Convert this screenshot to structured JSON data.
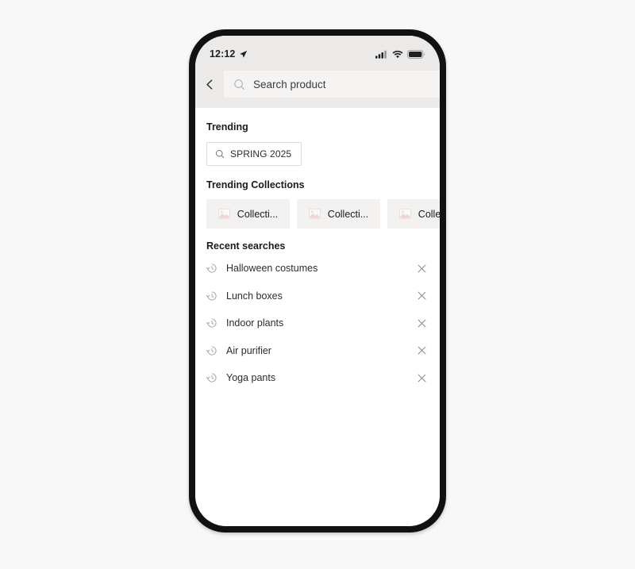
{
  "device": {
    "status_bar": {
      "time": "12:12",
      "location_icon": "location-arrow-icon",
      "cellular_icon": "cellular-signal-icon",
      "wifi_icon": "wifi-icon",
      "battery_icon": "battery-icon"
    }
  },
  "header": {
    "back_icon": "chevron-left-icon",
    "search": {
      "icon": "search-icon",
      "value": "",
      "placeholder": "Search product"
    }
  },
  "content": {
    "trending": {
      "title": "Trending",
      "chips": [
        {
          "icon": "search-icon",
          "label": "SPRING 2025"
        }
      ]
    },
    "trending_collections": {
      "title": "Trending Collections",
      "cards": [
        {
          "thumb_icon": "image-placeholder-icon",
          "label": "Collecti..."
        },
        {
          "thumb_icon": "image-placeholder-icon",
          "label": "Collecti..."
        },
        {
          "thumb_icon": "image-placeholder-icon",
          "label": "Collecti..."
        }
      ]
    },
    "recent_searches": {
      "title": "Recent searches",
      "item_icon": "history-clock-icon",
      "remove_icon": "close-icon",
      "items": [
        {
          "label": "Halloween costumes"
        },
        {
          "label": "Lunch boxes"
        },
        {
          "label": "Indoor plants"
        },
        {
          "label": "Air purifier"
        },
        {
          "label": "Yoga pants"
        }
      ]
    }
  },
  "colors": {
    "page_background": "#f8f8f8",
    "frame": "#111111",
    "screen": "#ffffff",
    "status_bar": "#eceae8",
    "header": "#eceae8",
    "search_field": "#f5f4f3",
    "card": "#f3f2f1",
    "text_primary": "#1a1a1f",
    "text_secondary": "#2b2b33",
    "icon_muted": "#9a9a9e",
    "chip_border": "#dcdcdc"
  }
}
